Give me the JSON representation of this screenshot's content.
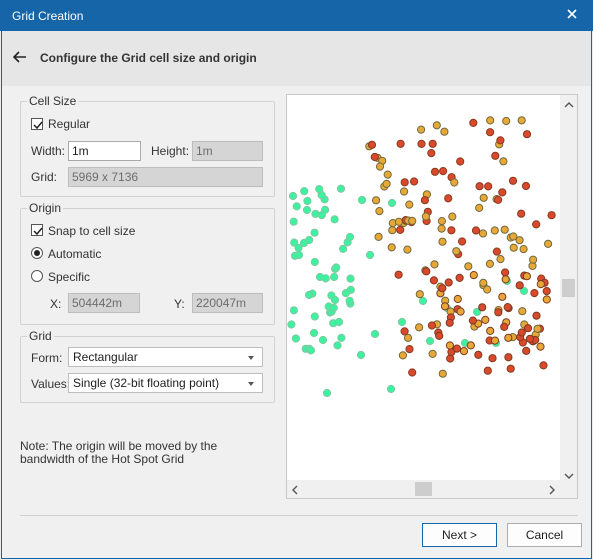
{
  "window": {
    "title": "Grid Creation"
  },
  "header": {
    "heading": "Configure the Grid cell size and origin"
  },
  "cell_size": {
    "legend": "Cell Size",
    "regular_label": "Regular",
    "regular_checked": true,
    "width_label": "Width:",
    "width_value": "1m",
    "height_label": "Height:",
    "height_value": "1m",
    "grid_label": "Grid:",
    "grid_value": "5969 x 7136"
  },
  "origin": {
    "legend": "Origin",
    "snap_label": "Snap to cell size",
    "snap_checked": true,
    "automatic_label": "Automatic",
    "specific_label": "Specific",
    "selected_mode": "Automatic",
    "x_label": "X:",
    "x_value": "504442m",
    "y_label": "Y:",
    "y_value": "220047m"
  },
  "grid": {
    "legend": "Grid",
    "form_label": "Form:",
    "form_value": "Rectangular",
    "values_label": "Values:",
    "values_value": "Single (32-bit floating point)"
  },
  "note": "Note: The origin will be moved by the bandwidth of the Hot Spot Grid",
  "buttons": {
    "next": "Next >",
    "cancel": "Cancel"
  },
  "colors": {
    "titlebar": "#1565a8",
    "point_green": "#3ef1a0",
    "point_red": "#d94a2c",
    "point_orange": "#e8a838"
  },
  "icons": {
    "close": "close-icon",
    "back": "back-arrow-icon"
  }
}
